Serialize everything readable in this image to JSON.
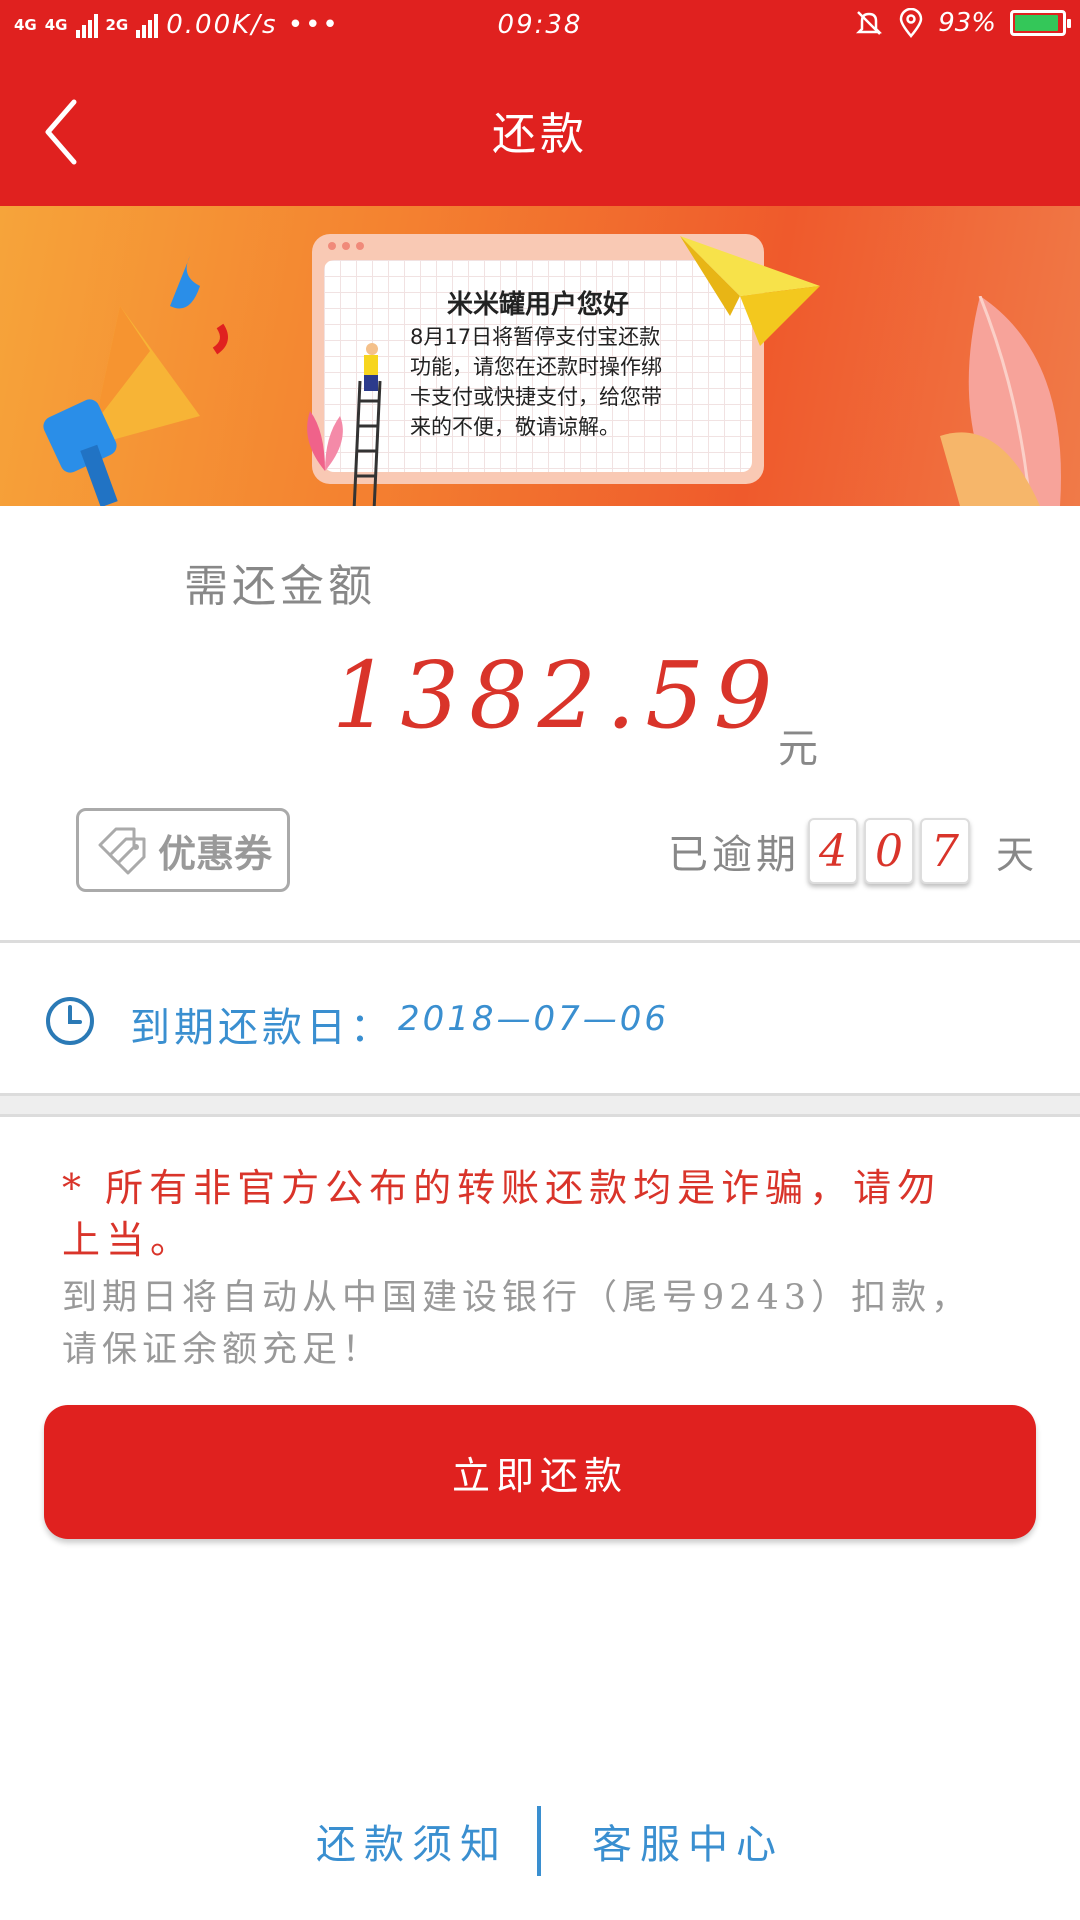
{
  "status_bar": {
    "network_1": "4G",
    "network_2": "4G",
    "network_3": "2G",
    "speed": "0.00K/s •••",
    "time": "09:38",
    "battery_percent": "93%",
    "battery_level": 0.93
  },
  "header": {
    "title": "还款"
  },
  "banner": {
    "title": "米米罐用户您好",
    "message": "8月17日将暂停支付宝还款功能，请您在还款时操作绑卡支付或快捷支付，给您带来的不便，敬请谅解。"
  },
  "amount": {
    "label": "需还金额",
    "value": "1382.59",
    "unit": "元"
  },
  "coupon": {
    "label": "优惠券"
  },
  "overdue": {
    "label": "已逾期",
    "digits": [
      "4",
      "0",
      "7"
    ],
    "unit": "天"
  },
  "due": {
    "label": "到期还款日：",
    "date": "2018—07—06"
  },
  "warning": {
    "text": "* 所有非官方公布的转账还款均是诈骗，请勿上当。"
  },
  "notice": {
    "text": "到期日将自动从中国建设银行（尾号9243）扣款，请保证余额充足！"
  },
  "pay_button": {
    "label": "立即还款"
  },
  "footer": {
    "link_notice": "还款须知",
    "link_service": "客服中心"
  },
  "colors": {
    "primary_red": "#e0211f",
    "amount_red": "#d9342a",
    "link_blue": "#3a8fd0"
  }
}
